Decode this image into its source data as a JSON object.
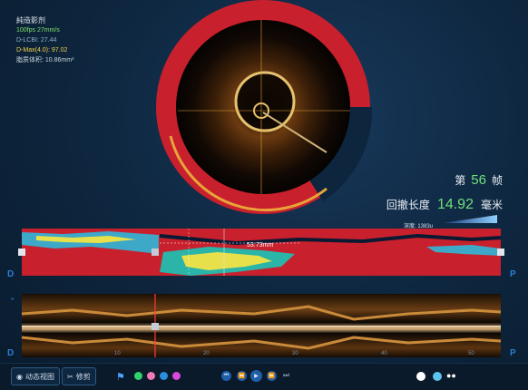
{
  "overlay": {
    "title": "純造影剂",
    "fps": "100fps 27mm/s",
    "dlcbi": "D-LCBI: 27.44",
    "dmax": "D-Max(4.0): 97.02",
    "volume": "脂质体积: 10.86mm³"
  },
  "frame": {
    "prefix": "第",
    "number": "56",
    "suffix": "帧"
  },
  "pullback": {
    "label": "回撤长度",
    "value": "14.92",
    "unit": "毫米"
  },
  "depth": {
    "label": "深度: 1383u"
  },
  "long_view": {
    "measure": "53.73mm",
    "ticks": [
      "10",
      "20",
      "30",
      "40",
      "50"
    ]
  },
  "side_labels": {
    "left": "D",
    "right": "P"
  },
  "toolbar": {
    "dynamic_view": "动态视图",
    "trim": "修剪",
    "color_dots": [
      "#2fd36b",
      "#f07ab3",
      "#2a8de0",
      "#d84ad8"
    ],
    "bottom_dots": [
      "#ffffff",
      "#5fc3f0"
    ]
  },
  "colors": {
    "lipid": "#c8202c",
    "accent": "#6fe07a"
  }
}
